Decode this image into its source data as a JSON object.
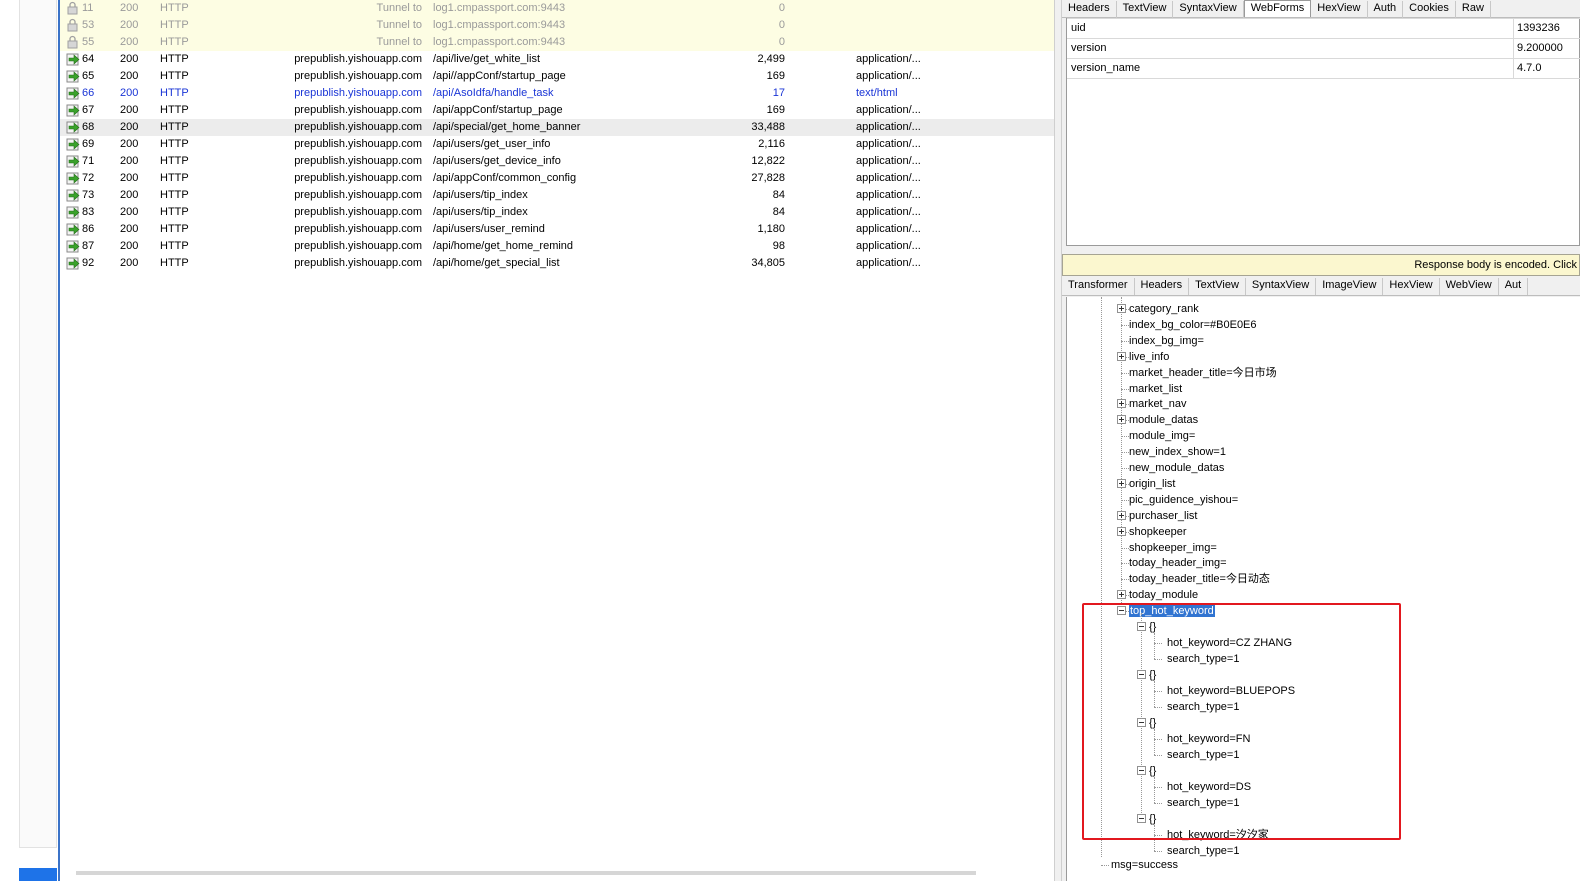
{
  "sessions": [
    {
      "num": "11",
      "result": "200",
      "protocol": "HTTP",
      "host": "Tunnel to",
      "url": "log1.cmpassport.com:9443",
      "body": "0",
      "content_type": "",
      "kind": "tunnel"
    },
    {
      "num": "53",
      "result": "200",
      "protocol": "HTTP",
      "host": "Tunnel to",
      "url": "log1.cmpassport.com:9443",
      "body": "0",
      "content_type": "",
      "kind": "tunnel"
    },
    {
      "num": "55",
      "result": "200",
      "protocol": "HTTP",
      "host": "Tunnel to",
      "url": "log1.cmpassport.com:9443",
      "body": "0",
      "content_type": "",
      "kind": "tunnel"
    },
    {
      "num": "64",
      "result": "200",
      "protocol": "HTTP",
      "host": "prepublish.yishouapp.com",
      "url": "/api/live/get_white_list",
      "body": "2,499",
      "content_type": "application/...",
      "kind": "normal"
    },
    {
      "num": "65",
      "result": "200",
      "protocol": "HTTP",
      "host": "prepublish.yishouapp.com",
      "url": "/api//appConf/startup_page",
      "body": "169",
      "content_type": "application/...",
      "kind": "normal"
    },
    {
      "num": "66",
      "result": "200",
      "protocol": "HTTP",
      "host": "prepublish.yishouapp.com",
      "url": "/api/AsoIdfa/handle_task",
      "body": "17",
      "content_type": "text/html",
      "kind": "blue"
    },
    {
      "num": "67",
      "result": "200",
      "protocol": "HTTP",
      "host": "prepublish.yishouapp.com",
      "url": "/api/appConf/startup_page",
      "body": "169",
      "content_type": "application/...",
      "kind": "normal"
    },
    {
      "num": "68",
      "result": "200",
      "protocol": "HTTP",
      "host": "prepublish.yishouapp.com",
      "url": "/api/special/get_home_banner",
      "body": "33,488",
      "content_type": "application/...",
      "kind": "selected"
    },
    {
      "num": "69",
      "result": "200",
      "protocol": "HTTP",
      "host": "prepublish.yishouapp.com",
      "url": "/api/users/get_user_info",
      "body": "2,116",
      "content_type": "application/...",
      "kind": "normal"
    },
    {
      "num": "71",
      "result": "200",
      "protocol": "HTTP",
      "host": "prepublish.yishouapp.com",
      "url": "/api/users/get_device_info",
      "body": "12,822",
      "content_type": "application/...",
      "kind": "normal"
    },
    {
      "num": "72",
      "result": "200",
      "protocol": "HTTP",
      "host": "prepublish.yishouapp.com",
      "url": "/api/appConf/common_config",
      "body": "27,828",
      "content_type": "application/...",
      "kind": "normal"
    },
    {
      "num": "73",
      "result": "200",
      "protocol": "HTTP",
      "host": "prepublish.yishouapp.com",
      "url": "/api/users/tip_index",
      "body": "84",
      "content_type": "application/...",
      "kind": "normal"
    },
    {
      "num": "83",
      "result": "200",
      "protocol": "HTTP",
      "host": "prepublish.yishouapp.com",
      "url": "/api/users/tip_index",
      "body": "84",
      "content_type": "application/...",
      "kind": "normal"
    },
    {
      "num": "86",
      "result": "200",
      "protocol": "HTTP",
      "host": "prepublish.yishouapp.com",
      "url": "/api/users/user_remind",
      "body": "1,180",
      "content_type": "application/...",
      "kind": "normal"
    },
    {
      "num": "87",
      "result": "200",
      "protocol": "HTTP",
      "host": "prepublish.yishouapp.com",
      "url": "/api/home/get_home_remind",
      "body": "98",
      "content_type": "application/...",
      "kind": "normal"
    },
    {
      "num": "92",
      "result": "200",
      "protocol": "HTTP",
      "host": "prepublish.yishouapp.com",
      "url": "/api/home/get_special_list",
      "body": "34,805",
      "content_type": "application/...",
      "kind": "normal"
    }
  ],
  "request_tabs": [
    "Headers",
    "TextView",
    "SyntaxView",
    "WebForms",
    "HexView",
    "Auth",
    "Cookies",
    "Raw"
  ],
  "request_active_tab": "WebForms",
  "request_params": [
    {
      "key": "uid",
      "value": "1393236"
    },
    {
      "key": "version",
      "value": "9.200000"
    },
    {
      "key": "version_name",
      "value": "4.7.0"
    }
  ],
  "encoded_notice": "Response body is encoded. Click",
  "response_tabs": [
    "Transformer",
    "Headers",
    "TextView",
    "SyntaxView",
    "ImageView",
    "HexView",
    "WebView",
    "Aut"
  ],
  "tree": {
    "nodes": [
      {
        "label": "category_rank",
        "expander": "plus"
      },
      {
        "label": "index_bg_color=#B0E0E6",
        "expander": ""
      },
      {
        "label": "index_bg_img=",
        "expander": ""
      },
      {
        "label": "live_info",
        "expander": "plus"
      },
      {
        "label": "market_header_title=今日市场",
        "expander": ""
      },
      {
        "label": "market_list",
        "expander": ""
      },
      {
        "label": "market_nav",
        "expander": "plus"
      },
      {
        "label": "module_datas",
        "expander": "plus"
      },
      {
        "label": "module_img=",
        "expander": ""
      },
      {
        "label": "new_index_show=1",
        "expander": ""
      },
      {
        "label": "new_module_datas",
        "expander": ""
      },
      {
        "label": "origin_list",
        "expander": "plus"
      },
      {
        "label": "pic_guidence_yishou=",
        "expander": ""
      },
      {
        "label": "purchaser_list",
        "expander": "plus"
      },
      {
        "label": "shopkeeper",
        "expander": "plus"
      },
      {
        "label": "shopkeeper_img=",
        "expander": ""
      },
      {
        "label": "today_header_img=",
        "expander": ""
      },
      {
        "label": "today_header_title=今日动态",
        "expander": ""
      },
      {
        "label": "today_module",
        "expander": "plus"
      },
      {
        "label": "top_hot_keyword",
        "expander": "minus",
        "selected": true
      }
    ],
    "hot_keywords": [
      {
        "obj": "{}",
        "keyword": "hot_keyword=CZ ZHANG",
        "type": "search_type=1"
      },
      {
        "obj": "{}",
        "keyword": "hot_keyword=BLUEPOPS",
        "type": "search_type=1"
      },
      {
        "obj": "{}",
        "keyword": "hot_keyword=FN",
        "type": "search_type=1"
      },
      {
        "obj": "{}",
        "keyword": "hot_keyword=DS",
        "type": "search_type=1"
      },
      {
        "obj": "{}",
        "keyword": "hot_keyword=汐汐家",
        "type": "search_type=1"
      }
    ],
    "msg": "msg=success"
  },
  "colors": {
    "highlight_box": "#e2181f",
    "tunnel_row": "#fdfde3",
    "link_blue": "#1a35d6",
    "tree_selection": "#3174d1"
  }
}
